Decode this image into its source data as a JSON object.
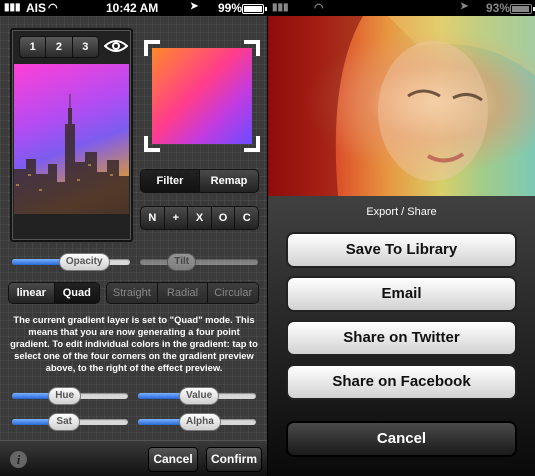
{
  "left": {
    "status": {
      "carrier": "AIS",
      "time": "10:42 AM",
      "battery": "99%",
      "battery_level": 0.99
    },
    "layer_tabs": [
      "1",
      "2",
      "3"
    ],
    "filter_remap": [
      "Filter",
      "Remap"
    ],
    "blend_buttons": [
      "N",
      "+",
      "X",
      "O",
      "C"
    ],
    "opacity_slider": {
      "label": "Opacity",
      "value": 0.55
    },
    "tilt_slider": {
      "label": "Tilt",
      "value": 0.35
    },
    "gradient_type": [
      "linear",
      "Quad"
    ],
    "gradient_style": [
      "Straight",
      "Radial",
      "Circular"
    ],
    "help_text": "The current gradient layer is set to \"Quad\" mode. This means that you are now generating a four point gradient. To edit individual colors in the gradient: tap to select one of the four corners on the gradient preview above, to the right of the effect preview.",
    "hue_slider": {
      "label": "Hue",
      "value": 0.45
    },
    "value_slider": {
      "label": "Value",
      "value": 0.5
    },
    "sat_slider": {
      "label": "Sat",
      "value": 0.45
    },
    "alpha_slider": {
      "label": "Alpha",
      "value": 0.5
    },
    "toolbar": {
      "info": "i",
      "cancel": "Cancel",
      "confirm": "Confirm"
    }
  },
  "right": {
    "status": {
      "battery": "93%",
      "battery_level": 0.93
    },
    "sheet_title": "Export / Share",
    "buttons": [
      "Save To Library",
      "Email",
      "Share on Twitter",
      "Share on Facebook"
    ],
    "cancel": "Cancel"
  }
}
